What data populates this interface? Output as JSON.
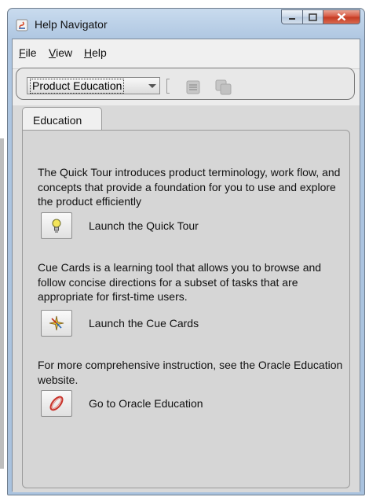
{
  "window": {
    "title": "Help Navigator",
    "menus": [
      {
        "label": "File",
        "mnemonic": "F",
        "rest": "ile"
      },
      {
        "label": "View",
        "mnemonic": "V",
        "rest": "iew"
      },
      {
        "label": "Help",
        "mnemonic": "H",
        "rest": "elp"
      }
    ]
  },
  "toolbar": {
    "product_select": "Product Education",
    "icons": [
      "navigator-icon",
      "topics-icon"
    ]
  },
  "tab": {
    "label": "Education"
  },
  "content": {
    "quick_tour": {
      "description": "The Quick Tour introduces product terminology, work flow, and concepts that provide a foundation for you to use and explore the product efficiently",
      "button_label": "Launch the Quick Tour",
      "icon": "lightbulb-icon"
    },
    "cue_cards": {
      "description": "Cue Cards is a learning tool that allows you to browse and follow concise directions for a subset of tasks that are appropriate for first-time users.",
      "button_label": "Launch the Cue Cards",
      "icon": "compass-icon"
    },
    "oracle_education": {
      "description": "For more comprehensive instruction, see the Oracle Education website.",
      "button_label": "Go to Oracle Education",
      "icon": "oracle-education-icon"
    }
  },
  "colors": {
    "title_bar": "#aec6e1",
    "close_button": "#c43a22",
    "panel_background": "#d6d6d6"
  }
}
